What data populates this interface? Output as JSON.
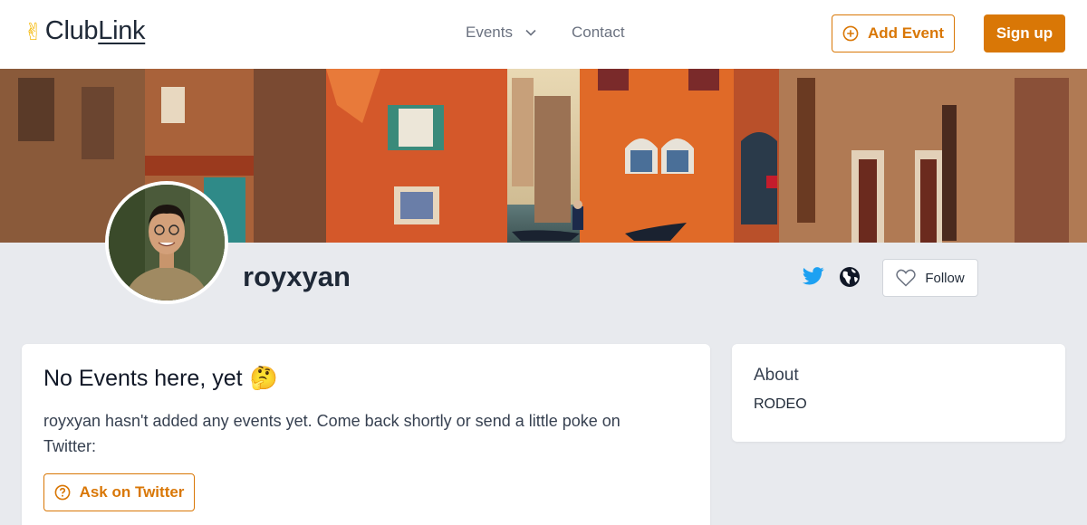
{
  "header": {
    "logo_hand": "✌",
    "logo_text_1": "Club",
    "logo_text_2": "Link",
    "nav_events": "Events",
    "nav_contact": "Contact",
    "add_event_label": "Add Event",
    "signup_label": "Sign up"
  },
  "profile": {
    "username": "royxyan",
    "follow_label": "Follow"
  },
  "events_card": {
    "title": "No Events here, yet",
    "title_emoji": "🤔",
    "message": "royxyan hasn't added any events yet. Come back shortly or send a little poke on Twitter:",
    "ask_label": "Ask on Twitter"
  },
  "about_card": {
    "title": "About",
    "text": "RODEO"
  },
  "colors": {
    "accent": "#d97706",
    "twitter": "#1da1f2",
    "background": "#e8eaee"
  },
  "icons": [
    "victory-hand-icon",
    "chevron-down-icon",
    "plus-circle-icon",
    "twitter-icon",
    "globe-icon",
    "heart-icon",
    "question-circle-icon"
  ]
}
